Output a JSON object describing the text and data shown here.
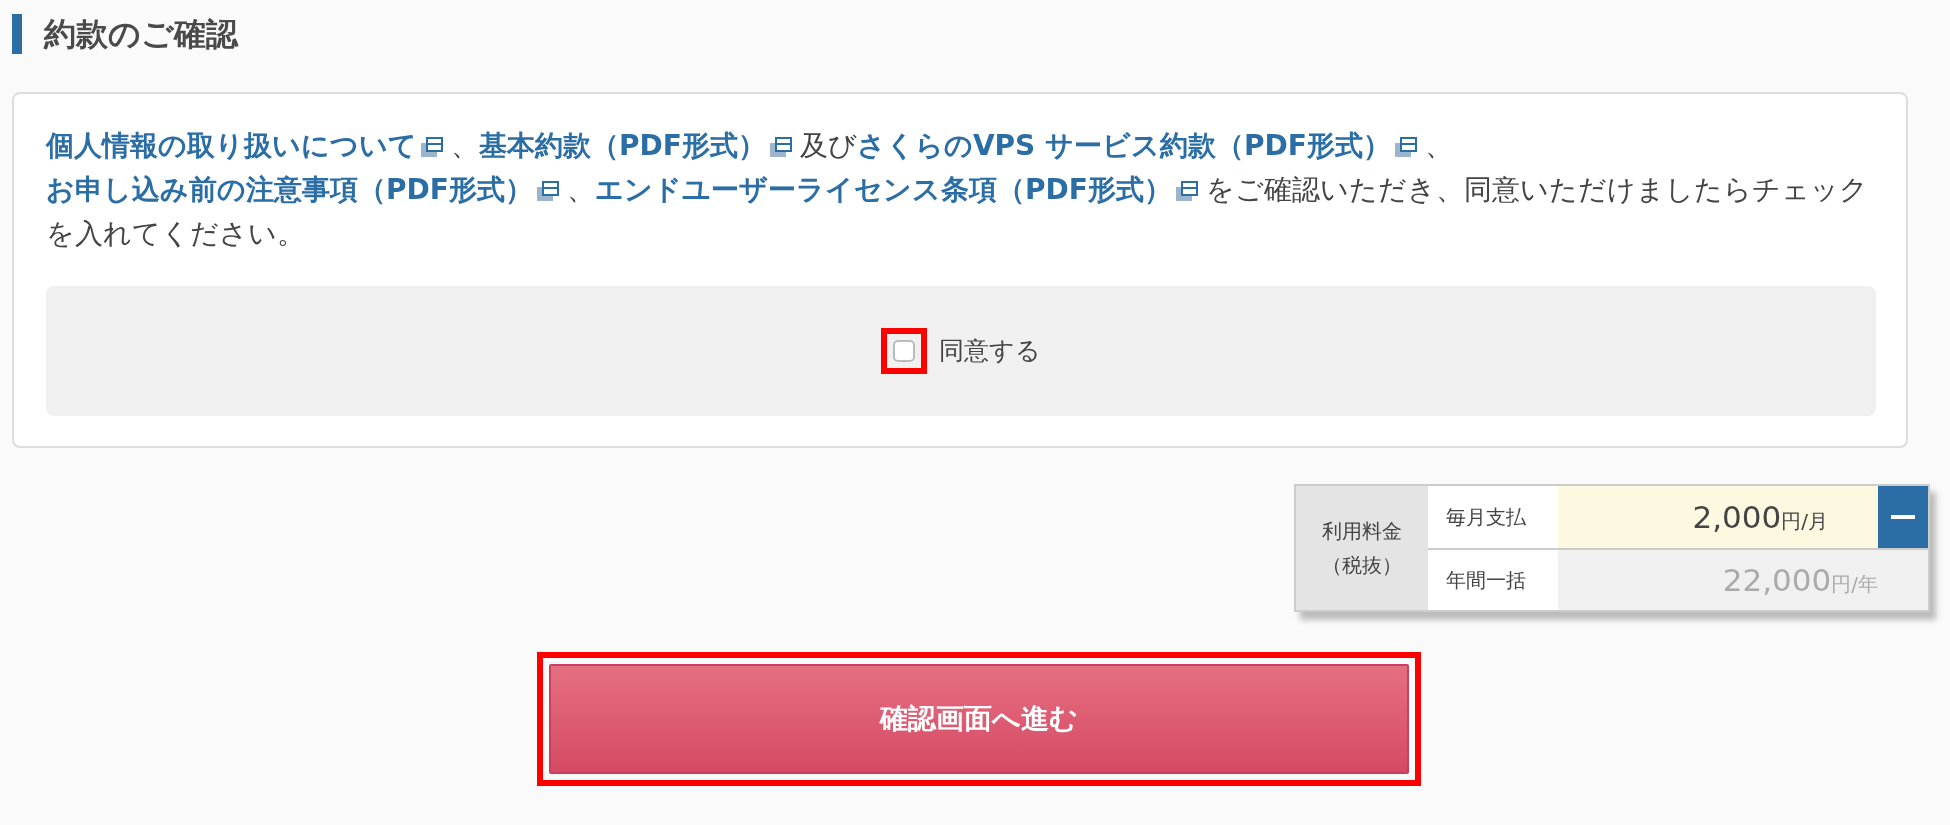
{
  "section_title": "約款のご確認",
  "consent_text": [
    {
      "kind": "link",
      "text": "個人情報の取り扱いについて"
    },
    {
      "kind": "text",
      "text": "、"
    },
    {
      "kind": "link",
      "text": "基本約款（PDF形式）"
    },
    {
      "kind": "text",
      "text": "及び"
    },
    {
      "kind": "link",
      "text": "さくらのVPS サービス約款（PDF形式）"
    },
    {
      "kind": "text",
      "text": "、"
    },
    {
      "kind": "link",
      "text": "お申し込み前の注意事項（PDF形式）"
    },
    {
      "kind": "text",
      "text": "、"
    },
    {
      "kind": "link",
      "text": "エンドユーザーライセンス条項（PDF形式）"
    },
    {
      "kind": "text",
      "text": "をご確認いただき、同意いただけましたらチェックを入れてください。"
    }
  ],
  "agree": {
    "label": "同意する",
    "checked": false,
    "highlighted": true
  },
  "price": {
    "label_lines": [
      "利用料金",
      "（税抜）"
    ],
    "rows": [
      {
        "label": "毎月支払",
        "amount": "2,000",
        "unit": "円/月",
        "selected": true
      },
      {
        "label": "年間一括",
        "amount": "22,000",
        "unit": "円/年",
        "selected": false
      }
    ]
  },
  "submit": {
    "label": "確認画面へ進む",
    "highlighted": true
  }
}
